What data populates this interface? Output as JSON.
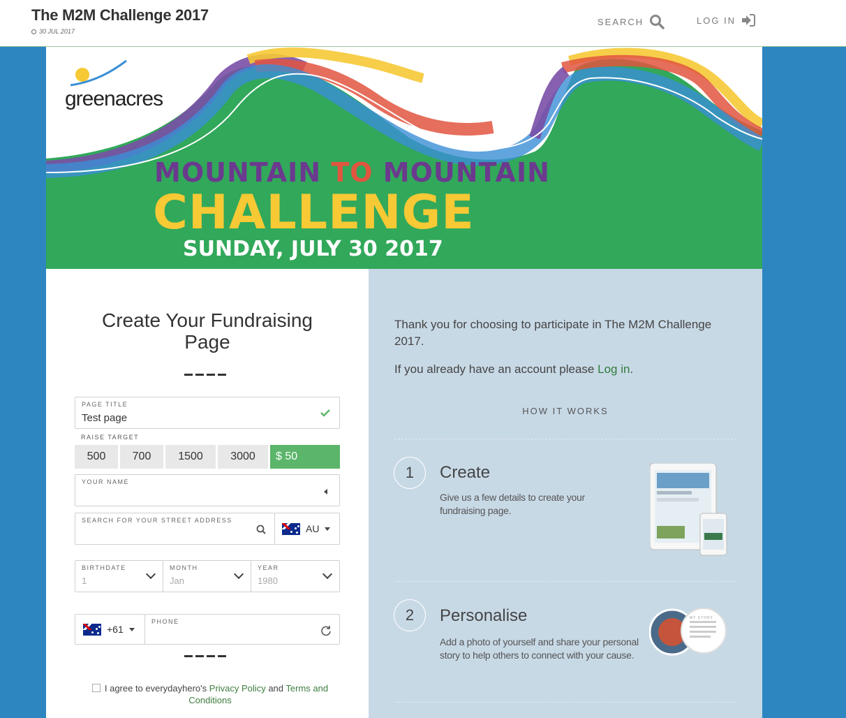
{
  "header": {
    "title": "The M2M Challenge 2017",
    "date": "30 JUL 2017",
    "search_label": "SEARCH",
    "login_label": "LOG IN"
  },
  "banner": {
    "logo_text": "greenacres",
    "line1_a": "MOUNTAIN ",
    "line1_b": "TO ",
    "line1_c": "MOUNTAIN",
    "line2": "CHALLENGE",
    "line3": "SUNDAY, JULY 30 2017"
  },
  "form": {
    "title": "Create Your Fundraising Page",
    "page_title_label": "PAGE TITLE",
    "page_title_value": "Test page",
    "raise_target_label": "RAISE TARGET",
    "raise_options": [
      "500",
      "700",
      "1500",
      "3000",
      "$ 50"
    ],
    "your_name_label": "YOUR NAME",
    "address_label": "SEARCH FOR YOUR STREET ADDRESS",
    "country_code": "AU",
    "birthdate_label": "BIRTHDATE",
    "birthdate_value": "1",
    "month_label": "MONTH",
    "month_value": "Jan",
    "year_label": "YEAR",
    "year_value": "1980",
    "phone_prefix": "+61",
    "phone_label": "PHONE",
    "agree_prefix": "I agree to everydayhero's",
    "privacy_link": "Privacy Policy",
    "and_word": "and",
    "terms_link": "Terms and Conditions"
  },
  "info": {
    "thanks": "Thank you for choosing to participate in The M2M Challenge 2017.",
    "already_text": "If you already have an account please",
    "login_link": "Log in",
    "period": ".",
    "how_it_works": "HOW IT WORKS",
    "steps": [
      {
        "num": "1",
        "title": "Create",
        "desc": "Give us a few details to create your fundraising page."
      },
      {
        "num": "2",
        "title": "Personalise",
        "desc": "Add a photo of yourself and share your personal story to help others to connect with your cause."
      }
    ],
    "story_label": "MY STORY"
  },
  "colors": {
    "side_blue": "#2e86c1",
    "panel_blue": "#c8d9e6",
    "banner_green": "#31a85a",
    "selected_green": "#5bb56a",
    "link_green": "#2f7b3b"
  }
}
